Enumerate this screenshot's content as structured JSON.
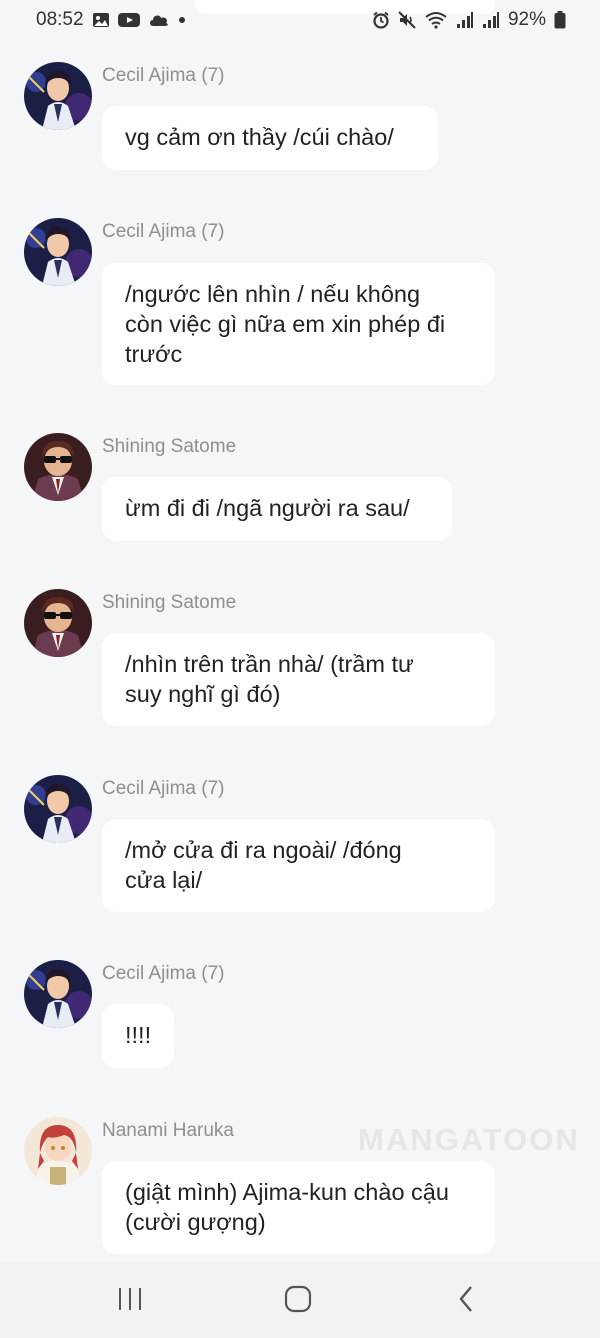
{
  "status": {
    "time": "08:52",
    "battery": "92%"
  },
  "icons": {
    "left": [
      "image-icon",
      "youtube-icon",
      "cloud-icon",
      "dot-icon"
    ],
    "right": [
      "alarm-icon",
      "mute-icon",
      "wifi-icon",
      "signal-icon",
      "signal-icon",
      "battery-icon"
    ]
  },
  "messages": [
    {
      "sender": "Cecil Ajima (7)",
      "avatar": "cecil",
      "text": "vg cảm ơn thầy /cúi chào/"
    },
    {
      "sender": "Cecil Ajima (7)",
      "avatar": "cecil",
      "text": "/ngước lên nhìn / nếu không\ncòn việc gì nữa em xin phép đi\ntrước"
    },
    {
      "sender": "Shining Satome",
      "avatar": "shining",
      "text": "ừm đi đi /ngã người ra sau/"
    },
    {
      "sender": "Shining Satome",
      "avatar": "shining",
      "text": "/nhìn trên trần nhà/ (trầm tư\nsuy nghĩ gì đó)"
    },
    {
      "sender": "Cecil Ajima (7)",
      "avatar": "cecil",
      "text": "/mở cửa đi ra ngoài/ /đóng\ncửa lại/"
    },
    {
      "sender": "Cecil Ajima (7)",
      "avatar": "cecil",
      "text": "!!!!"
    },
    {
      "sender": "Nanami Haruka",
      "avatar": "nanami",
      "text": "(giật mình) Ajima-kun chào cậu\n(cười gượng)"
    }
  ],
  "watermark": "MANGATOON",
  "nav": {
    "recents": "recent-apps-icon",
    "home": "home-icon",
    "back": "back-icon"
  }
}
